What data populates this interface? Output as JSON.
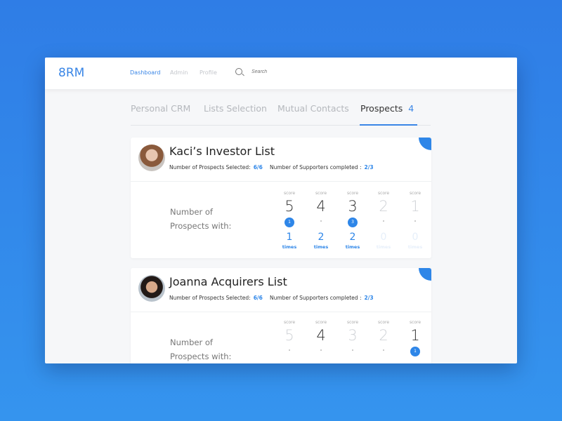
{
  "header": {
    "logo": "8RM",
    "nav": [
      {
        "label": "Dashboard",
        "active": true
      },
      {
        "label": "Admin",
        "active": false
      },
      {
        "label": "Profile",
        "active": false
      }
    ],
    "search_placeholder": "Search"
  },
  "tabs": [
    {
      "label": "Personal CRM"
    },
    {
      "label": "Lists Selection"
    },
    {
      "label": "Mutual Contacts"
    },
    {
      "label": "Prospects",
      "count": "4",
      "active": true
    }
  ],
  "accent": "#2e86e8",
  "cards": [
    {
      "title": "Kaci’s Investor List",
      "prospects_label": "Number of Prospects Selected:",
      "prospects_value": "6/6",
      "supporters_label": "Number of Supporters completed :",
      "supporters_value": "2/3",
      "npw": [
        "Number of",
        "Prospects with:"
      ],
      "scores": [
        {
          "label": "score",
          "score": "5",
          "badge": "1",
          "count": "1",
          "unit": "times",
          "active": true
        },
        {
          "label": "score",
          "score": "4",
          "badge": null,
          "count": "2",
          "unit": "times",
          "active": true
        },
        {
          "label": "score",
          "score": "3",
          "badge": "3",
          "count": "2",
          "unit": "times",
          "active": true
        },
        {
          "label": "score",
          "score": "2",
          "badge": null,
          "count": "0",
          "unit": "times",
          "active": false
        },
        {
          "label": "score",
          "score": "1",
          "badge": null,
          "count": "0",
          "unit": "times",
          "active": false
        }
      ]
    },
    {
      "title": "Joanna Acquirers List",
      "prospects_label": "Number of Prospects Selected:",
      "prospects_value": "6/6",
      "supporters_label": "Number of Supporters completed :",
      "supporters_value": "2/3",
      "npw": [
        "Number of",
        "Prospects with:"
      ],
      "scores": [
        {
          "label": "score",
          "score": "5",
          "badge": null,
          "active": false
        },
        {
          "label": "score",
          "score": "4",
          "badge": null,
          "active": true
        },
        {
          "label": "score",
          "score": "3",
          "badge": null,
          "active": false
        },
        {
          "label": "score",
          "score": "2",
          "badge": null,
          "active": false
        },
        {
          "label": "score",
          "score": "1",
          "badge": "1",
          "active": true
        }
      ]
    }
  ]
}
